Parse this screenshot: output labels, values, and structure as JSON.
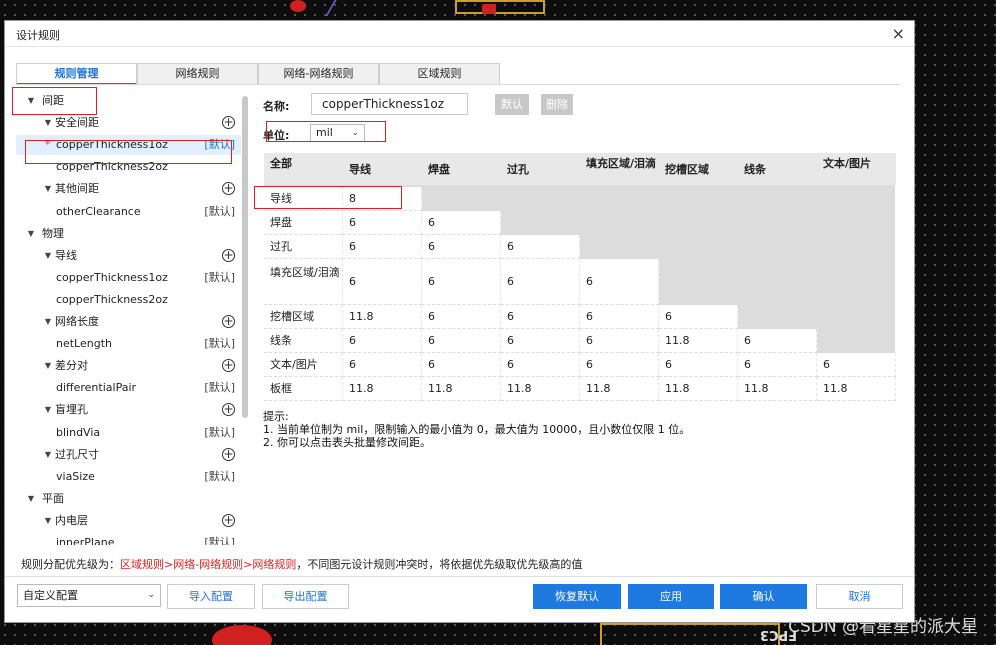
{
  "window": {
    "title": "设计规则"
  },
  "pcb": {
    "labels": [
      "FPC3"
    ],
    "watermark": "CSDN @看星星的派大星"
  },
  "tabs": [
    "规则管理",
    "网络规则",
    "网络-网络规则",
    "区域规则"
  ],
  "tree": [
    {
      "label": "间距",
      "level": 0,
      "caret": true
    },
    {
      "label": "安全间距",
      "level": 1,
      "caret": true,
      "add": true
    },
    {
      "label": "copperThickness1oz",
      "level": 2,
      "tag": "[默认]",
      "star": true,
      "selected": true
    },
    {
      "label": "copperThickness2oz",
      "level": 2
    },
    {
      "label": "其他间距",
      "level": 1,
      "caret": true,
      "add": true
    },
    {
      "label": "otherClearance",
      "level": 2,
      "tag": "[默认]"
    },
    {
      "label": "物理",
      "level": 0,
      "caret": true
    },
    {
      "label": "导线",
      "level": 1,
      "caret": true,
      "add": true
    },
    {
      "label": "copperThickness1oz",
      "level": 2,
      "tag": "[默认]"
    },
    {
      "label": "copperThickness2oz",
      "level": 2
    },
    {
      "label": "网络长度",
      "level": 1,
      "caret": true,
      "add": true
    },
    {
      "label": "netLength",
      "level": 2,
      "tag": "[默认]"
    },
    {
      "label": "差分对",
      "level": 1,
      "caret": true,
      "add": true
    },
    {
      "label": "differentialPair",
      "level": 2,
      "tag": "[默认]"
    },
    {
      "label": "盲埋孔",
      "level": 1,
      "caret": true,
      "add": true
    },
    {
      "label": "blindVia",
      "level": 2,
      "tag": "[默认]"
    },
    {
      "label": "过孔尺寸",
      "level": 1,
      "caret": true,
      "add": true
    },
    {
      "label": "viaSize",
      "level": 2,
      "tag": "[默认]"
    },
    {
      "label": "平面",
      "level": 0,
      "caret": true
    },
    {
      "label": "内电层",
      "level": 1,
      "caret": true,
      "add": true
    },
    {
      "label": "innerPlane",
      "level": 2,
      "tag": "[默认]"
    }
  ],
  "form": {
    "name_label": "名称:",
    "name_value": "copperThickness1oz",
    "default_button": "默认",
    "delete_button": "删除",
    "unit_label": "单位:",
    "unit_value": "mil"
  },
  "clearance_table": {
    "corner": "全部",
    "headers": [
      "导线",
      "焊盘",
      "过孔",
      "填充区域/泪滴",
      "挖槽区域",
      "线条",
      "文本/图片"
    ],
    "rows": [
      {
        "label": "导线",
        "values": [
          "8"
        ]
      },
      {
        "label": "焊盘",
        "values": [
          "6",
          "6"
        ]
      },
      {
        "label": "过孔",
        "values": [
          "6",
          "6",
          "6"
        ]
      },
      {
        "label": "填充区域/泪滴",
        "values": [
          "6",
          "6",
          "6",
          "6"
        ]
      },
      {
        "label": "挖槽区域",
        "values": [
          "11.8",
          "6",
          "6",
          "6",
          "6"
        ]
      },
      {
        "label": "线条",
        "values": [
          "6",
          "6",
          "6",
          "6",
          "11.8",
          "6"
        ]
      },
      {
        "label": "文本/图片",
        "values": [
          "6",
          "6",
          "6",
          "6",
          "6",
          "6",
          "6"
        ]
      },
      {
        "label": "板框",
        "values": [
          "11.8",
          "11.8",
          "11.8",
          "11.8",
          "11.8",
          "11.8",
          "11.8"
        ]
      }
    ]
  },
  "hint": {
    "title": "提示:",
    "lines": [
      "1. 当前单位制为 mil，限制输入的最小值为 0，最大值为 10000，且小数位仅限 1 位。",
      "2. 你可以点击表头批量修改间距。"
    ]
  },
  "priority": {
    "prefix": "规则分配优先级为：",
    "order": "区域规则>网络-网络规则>网络规则",
    "suffix": "，不同图元设计规则冲突时，将依据优先级取优先级高的值"
  },
  "footer": {
    "config_value": "自定义配置",
    "import_button": "导入配置",
    "export_button": "导出配置",
    "restore_button": "恢复默认",
    "apply_button": "应用",
    "ok_button": "确认",
    "cancel_button": "取消"
  },
  "colors": {
    "accent": "#1e7ae0",
    "highlight_box": "#e02020",
    "selected_row": "#e3efff"
  }
}
